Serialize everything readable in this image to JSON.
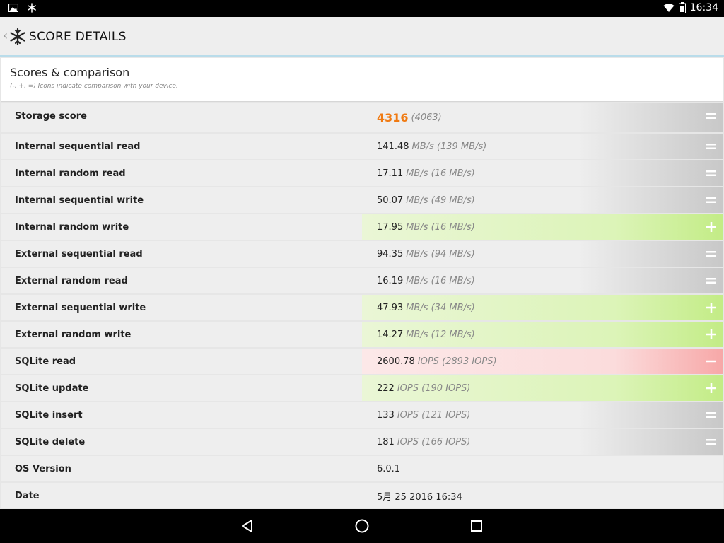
{
  "status_bar": {
    "time": "16:34",
    "icons": [
      "image-icon",
      "snowflake-icon",
      "wifi-icon",
      "battery-icon"
    ]
  },
  "action_bar": {
    "title": "SCORE DETAILS",
    "back_icon": "chevron-left-icon",
    "logo_icon": "snowflake-icon"
  },
  "header": {
    "title": "Scores & comparison",
    "subtitle": "(-, +, =) Icons indicate comparison with your device."
  },
  "rows": [
    {
      "label": "Storage score",
      "value": "4316",
      "compare": "(4063)",
      "status": "neutral"
    },
    {
      "label": "Internal sequential read",
      "value": "141.48",
      "compare": "MB/s (139 MB/s)",
      "status": "neutral"
    },
    {
      "label": "Internal random read",
      "value": "17.11",
      "compare": "MB/s (16 MB/s)",
      "status": "neutral"
    },
    {
      "label": "Internal sequential write",
      "value": "50.07",
      "compare": "MB/s (49 MB/s)",
      "status": "neutral"
    },
    {
      "label": "Internal random write",
      "value": "17.95",
      "compare": "MB/s (16 MB/s)",
      "status": "plus"
    },
    {
      "label": "External sequential read",
      "value": "94.35",
      "compare": "MB/s (94 MB/s)",
      "status": "neutral"
    },
    {
      "label": "External random read",
      "value": "16.19",
      "compare": "MB/s (16 MB/s)",
      "status": "neutral"
    },
    {
      "label": "External sequential write",
      "value": "47.93",
      "compare": "MB/s (34 MB/s)",
      "status": "plus"
    },
    {
      "label": "External random write",
      "value": "14.27",
      "compare": "MB/s (12 MB/s)",
      "status": "plus"
    },
    {
      "label": "SQLite read",
      "value": "2600.78",
      "compare": "IOPS (2893 IOPS)",
      "status": "minus"
    },
    {
      "label": "SQLite update",
      "value": "222",
      "compare": "IOPS (190 IOPS)",
      "status": "plus"
    },
    {
      "label": "SQLite insert",
      "value": "133",
      "compare": "IOPS (121 IOPS)",
      "status": "neutral"
    },
    {
      "label": "SQLite delete",
      "value": "181",
      "compare": "IOPS (166 IOPS)",
      "status": "neutral"
    },
    {
      "label": "OS Version",
      "value": "6.0.1",
      "compare": "",
      "status": "plain"
    },
    {
      "label": "Date",
      "value": "5月 25 2016 16:34",
      "compare": "",
      "status": "plain"
    }
  ],
  "colors": {
    "accent_score": "#f07a12",
    "plus_green": "#c3ec86",
    "minus_red": "#f7a8a8",
    "neutral_gray": "#c8c8c8"
  },
  "nav_bar": {
    "icons": [
      "back-triangle-icon",
      "home-circle-icon",
      "recents-square-icon"
    ]
  }
}
